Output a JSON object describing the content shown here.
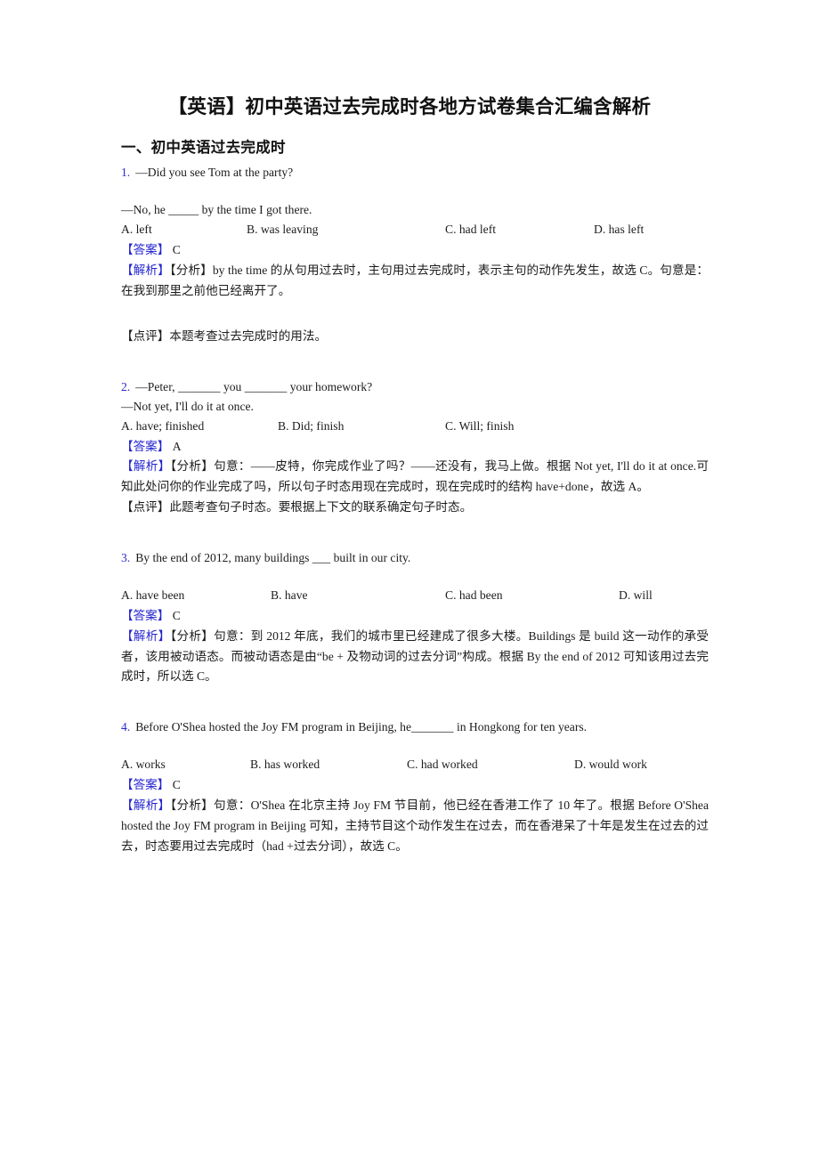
{
  "document": {
    "title": "【英语】初中英语过去完成时各地方试卷集合汇编含解析",
    "section_heading": "一、初中英语过去完成时",
    "markers": {
      "answer": "【答案】",
      "explanation": "【解析】",
      "analysis": "【分析】",
      "comment": "【点评】"
    },
    "colors": {
      "marker_blue": "#2424cf",
      "question_number_blue": "#2a2ad0",
      "text_black": "#1c1c1c"
    }
  },
  "questions": [
    {
      "number": "1.",
      "stem": "—Did you see Tom at the party?",
      "stem2": "—No, he _____ by the time I got there.",
      "options": [
        "A. left",
        "B. was leaving",
        "C. had left",
        "D. has left"
      ],
      "answer_label": "【答案】",
      "answer": "C",
      "explanation_label": "【解析】",
      "analysis_label": "【分析】",
      "explanation": "by the time 的从句用过去时，主句用过去完成时，表示主句的动作先发生，故选 C。句意是：在我到那里之前他已经离开了。",
      "comment_label": "【点评】",
      "comment": "本题考查过去完成时的用法。"
    },
    {
      "number": "2.",
      "stem": "—Peter, _______ you _______ your homework?",
      "stem2": "—Not yet, I'll do it at once.",
      "options": [
        "A. have; finished",
        "B. Did; finish",
        "C. Will; finish"
      ],
      "answer_label": "【答案】",
      "answer": "A",
      "explanation_label": "【解析】",
      "analysis_label": "【分析】",
      "explanation": "句意：——皮特，你完成作业了吗？——还没有，我马上做。根据 Not yet, I'll do it at once.可知此处问你的作业完成了吗，所以句子时态用现在完成时，现在完成时的结构 have+done，故选 A。",
      "comment_label": "【点评】",
      "comment": "此题考查句子时态。要根据上下文的联系确定句子时态。"
    },
    {
      "number": "3.",
      "stem": "By the end of 2012, many buildings ___ built in our city.",
      "stem2": "",
      "options": [
        "A. have been",
        "B. have",
        "C. had been",
        "D. will"
      ],
      "answer_label": "【答案】",
      "answer": "C",
      "explanation_label": "【解析】",
      "analysis_label": "【分析】",
      "explanation": "句意：到 2012 年底，我们的城市里已经建成了很多大楼。Buildings 是 build 这一动作的承受者，该用被动语态。而被动语态是由“be + 及物动词的过去分词”构成。根据 By the end of 2012 可知该用过去完成时，所以选 C。",
      "comment_label": "",
      "comment": ""
    },
    {
      "number": "4.",
      "stem": "Before O'Shea hosted the Joy FM program in Beijing, he_______ in Hongkong for ten years.",
      "stem2": "",
      "options": [
        "A. works",
        "B. has worked",
        "C. had worked",
        "D. would work"
      ],
      "answer_label": "【答案】",
      "answer": "C",
      "explanation_label": "【解析】",
      "analysis_label": "【分析】",
      "explanation": "句意：O'Shea 在北京主持 Joy FM 节目前，他已经在香港工作了 10 年了。根据 Before O'Shea hosted the Joy FM program in Beijing 可知，主持节目这个动作发生在过去，而在香港呆了十年是发生在过去的过去，时态要用过去完成时（had +过去分词），故选 C。",
      "comment_label": "",
      "comment": ""
    }
  ]
}
